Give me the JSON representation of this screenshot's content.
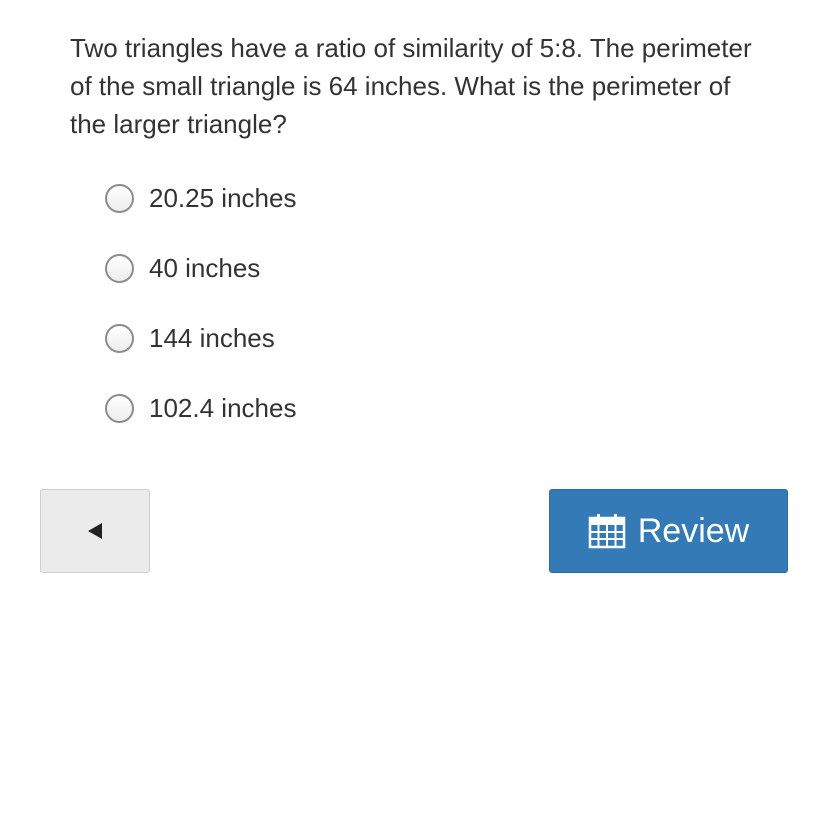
{
  "question": {
    "text": "Two triangles have a ratio of similarity of 5:8. The perimeter of the small triangle is 64 inches. What is the perimeter of the larger triangle?"
  },
  "options": [
    {
      "label": "20.25 inches",
      "selected": false
    },
    {
      "label": "40 inches",
      "selected": false
    },
    {
      "label": "144 inches",
      "selected": false
    },
    {
      "label": "102.4 inches",
      "selected": false
    }
  ],
  "navigation": {
    "back_icon": "triangle-left-icon",
    "review_icon": "calendar-icon",
    "review_label": "Review"
  },
  "colors": {
    "primary": "#337ab7",
    "back_button_bg": "#ebebeb",
    "text": "#333333"
  }
}
